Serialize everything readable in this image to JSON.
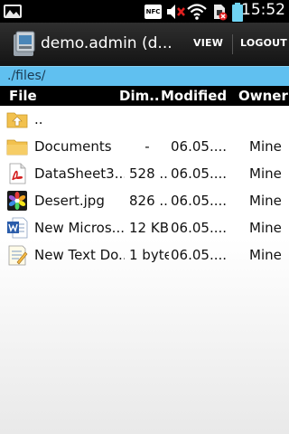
{
  "status_bar": {
    "nfc_label": "NFC",
    "time": "15:52",
    "icons": [
      "gallery-icon",
      "nfc-icon",
      "mute-icon",
      "wifi-icon",
      "sim-error-icon",
      "battery-icon"
    ]
  },
  "action_bar": {
    "title": "demo.admin (d...",
    "view_label": "VIEW",
    "logout_label": "LOGOUT"
  },
  "path": "./files/",
  "table": {
    "headers": {
      "file": "File",
      "dim": "Dim...",
      "modified": "Modified",
      "owner": "Owner"
    },
    "rows": [
      {
        "icon": "folder-up-icon",
        "name": "..",
        "size": "",
        "modified": "",
        "owner": ""
      },
      {
        "icon": "folder-icon",
        "name": "Documents",
        "size": "-",
        "modified": "06.05....",
        "owner": "Mine"
      },
      {
        "icon": "pdf-icon",
        "name": "DataSheet3....",
        "size": "528 ...",
        "modified": "06.05....",
        "owner": "Mine"
      },
      {
        "icon": "image-file-icon",
        "name": "Desert.jpg",
        "size": "826 ...",
        "modified": "06.05....",
        "owner": "Mine"
      },
      {
        "icon": "word-doc-icon",
        "name": "New Micros...",
        "size": "12 KB",
        "modified": "06.05....",
        "owner": "Mine"
      },
      {
        "icon": "text-file-icon",
        "name": "New Text Do...",
        "size": "1 byte",
        "modified": "06.05....",
        "owner": "Mine"
      }
    ]
  },
  "colors": {
    "path_bar": "#60c0f0",
    "action_bar": "#1f1f1f",
    "header": "#000000",
    "folder": "#f2c14e"
  }
}
